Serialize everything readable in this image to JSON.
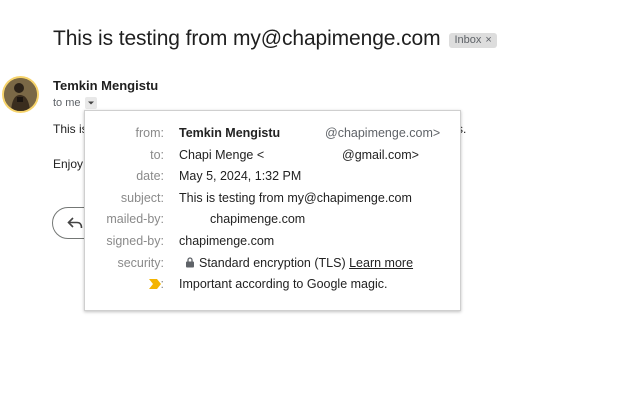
{
  "email": {
    "subject": "This is testing from my@chapimenge.com",
    "label": "Inbox",
    "label_close": "×",
    "sender_name": "Temkin Mengistu",
    "to_line": "to me",
    "body": {
      "line1_start": "This is",
      "line1_end": "s.",
      "line2_start": "Enjoy"
    }
  },
  "details": {
    "from_label": "from:",
    "from_name": "Temkin Mengistu",
    "from_addr": "@chapimenge.com>",
    "to_label": "to:",
    "to_name": "Chapi Menge <",
    "to_addr": "@gmail.com>",
    "date_label": "date:",
    "date_value": "May 5, 2024, 1:32 PM",
    "subject_label": "subject:",
    "subject_value": "This is testing from my@chapimenge.com",
    "mailedby_label": "mailed-by:",
    "mailedby_value": "chapimenge.com",
    "signedby_label": "signed-by:",
    "signedby_value": "chapimenge.com",
    "security_label": "security:",
    "security_value": "Standard encryption (TLS)",
    "security_link": "Learn more",
    "importance_label": ":",
    "importance_value": "Important according to Google magic."
  },
  "colors": {
    "importance_marker": "#f4b400",
    "avatar_ring": "#f6d36b"
  },
  "icons": {
    "importance": "importance-marker-icon",
    "lock": "lock-icon",
    "caret": "caret-down-icon",
    "reply": "reply-arrow-icon"
  }
}
